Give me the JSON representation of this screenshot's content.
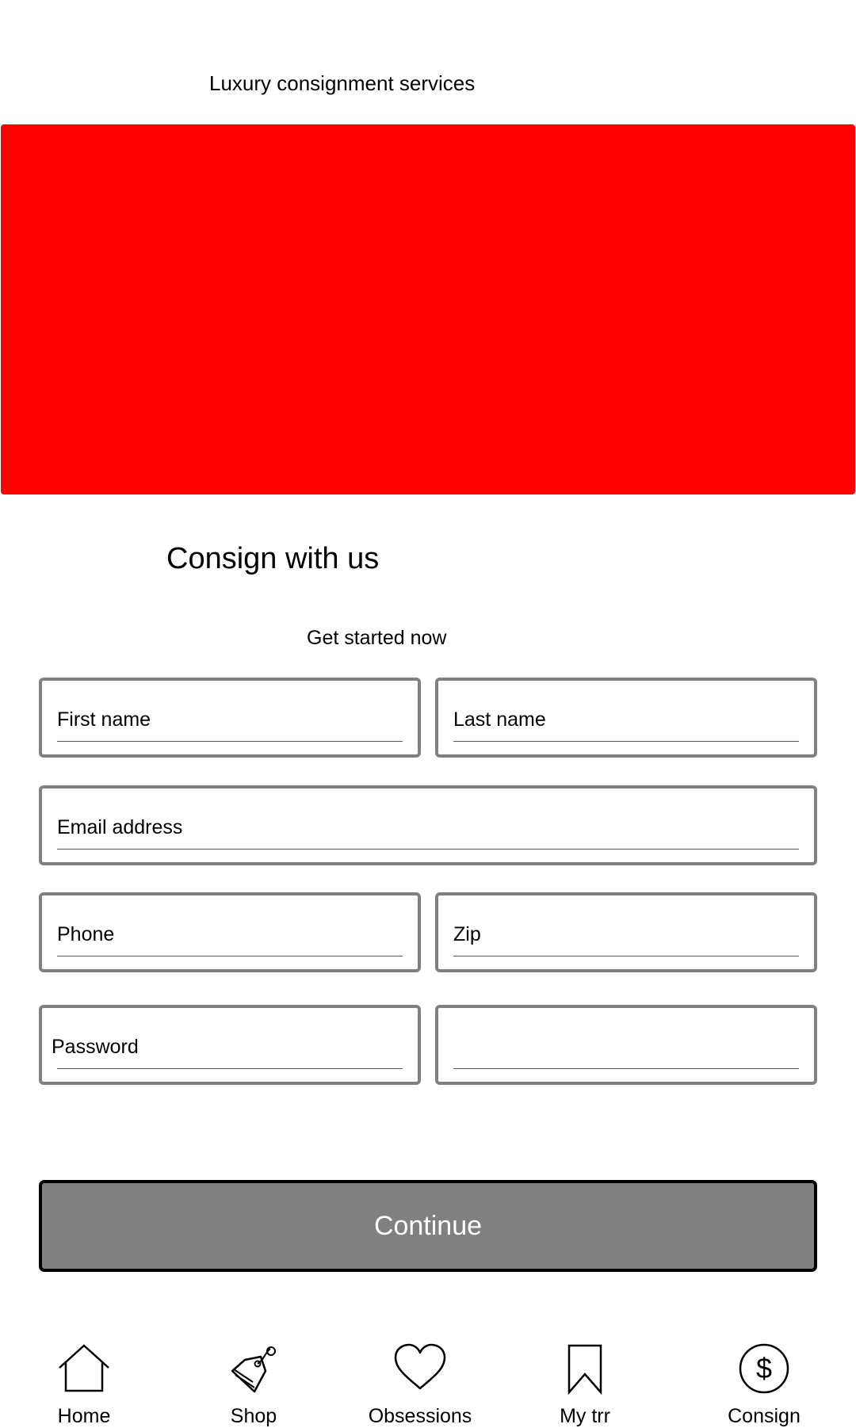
{
  "header": {
    "subtitle": "Luxury consignment services"
  },
  "hero": {
    "color": "#ff0000"
  },
  "section": {
    "heading": "Consign with us",
    "intro": "Get started now"
  },
  "form": {
    "first_name_label": "First name",
    "last_name_label": "Last name",
    "email_label": "Email address",
    "phone_label": "Phone",
    "zip_label": "Zip",
    "password_label": "Password",
    "confirm_label": ""
  },
  "actions": {
    "continue_label": "Continue"
  },
  "nav": {
    "items": [
      {
        "label": "Home",
        "icon": "home-icon"
      },
      {
        "label": "Shop",
        "icon": "tag-icon"
      },
      {
        "label": "Obsessions",
        "icon": "heart-icon"
      },
      {
        "label": "My trr",
        "icon": "bookmark-icon"
      },
      {
        "label": "Consign",
        "icon": "dollar-icon"
      }
    ]
  }
}
